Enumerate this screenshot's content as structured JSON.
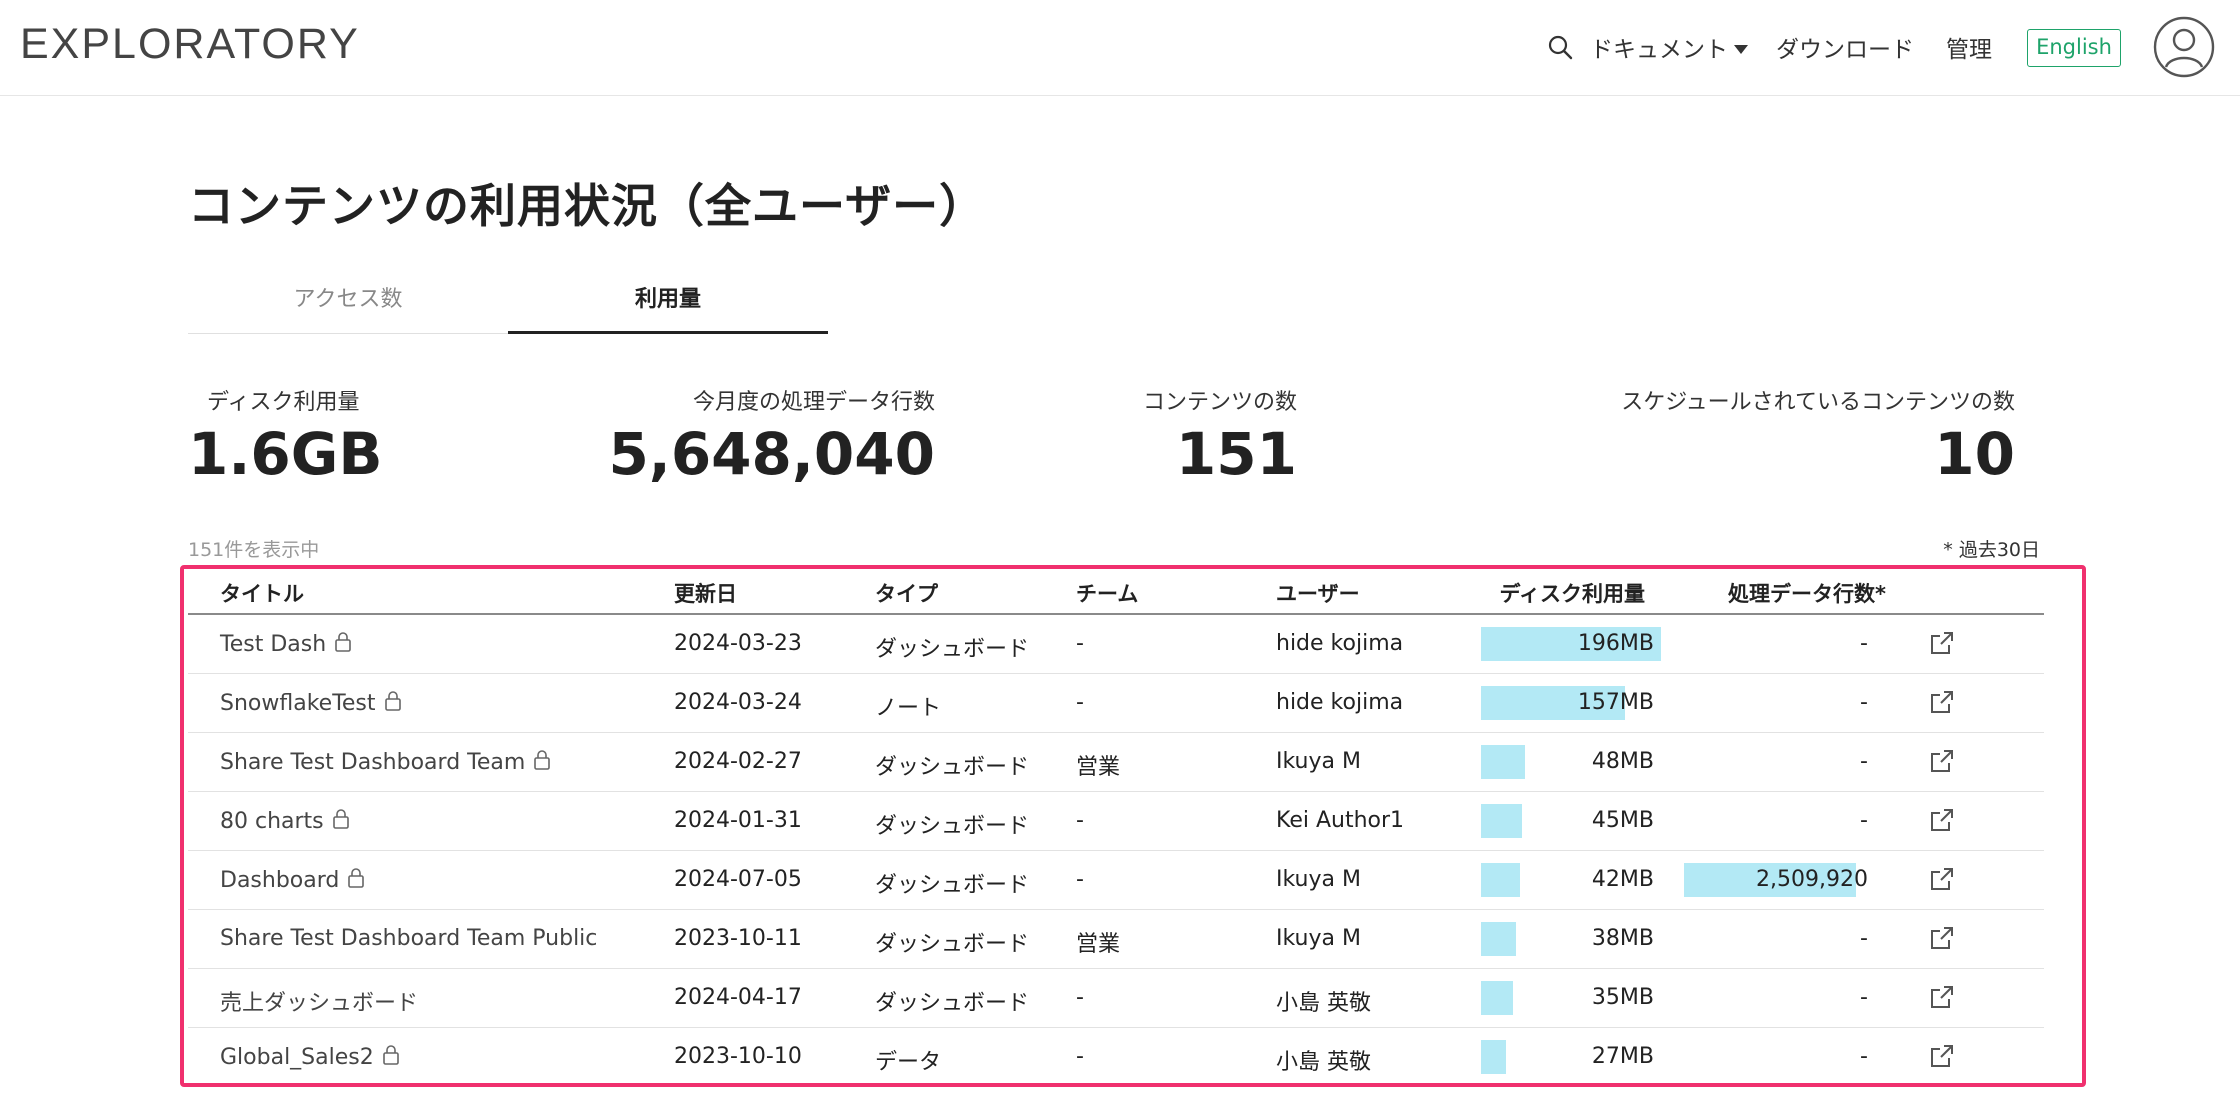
{
  "header": {
    "brand": "EXPLORATORY",
    "docs": "ドキュメント",
    "download": "ダウンロード",
    "admin": "管理",
    "language": "English"
  },
  "page": {
    "title": "コンテンツの利用状況（全ユーザー）"
  },
  "tabs": [
    {
      "label": "アクセス数",
      "active": false
    },
    {
      "label": "利用量",
      "active": true
    }
  ],
  "stats": [
    {
      "label": "ディスク利用量",
      "value": "1.6GB"
    },
    {
      "label": "今月度の処理データ行数",
      "value": "5,648,040"
    },
    {
      "label": "コンテンツの数",
      "value": "151"
    },
    {
      "label": "スケジュールされているコンテンツの数",
      "value": "10"
    }
  ],
  "table_meta": {
    "count_text": "151件を表示中",
    "note": "* 過去30日"
  },
  "table": {
    "headers": [
      "タイトル",
      "更新日",
      "タイプ",
      "チーム",
      "ユーザー",
      "ディスク利用量",
      "処理データ行数*"
    ],
    "rows": [
      {
        "title": "Test Dash",
        "locked": true,
        "date": "2024-03-23",
        "type": "ダッシュボード",
        "team": "-",
        "user": "hide kojima",
        "disk": "196MB",
        "disk_mb": 196,
        "rows": "-",
        "rows_num": 0
      },
      {
        "title": "SnowflakeTest",
        "locked": true,
        "date": "2024-03-24",
        "type": "ノート",
        "team": "-",
        "user": "hide kojima",
        "disk": "157MB",
        "disk_mb": 157,
        "rows": "-",
        "rows_num": 0
      },
      {
        "title": "Share Test Dashboard Team",
        "locked": true,
        "date": "2024-02-27",
        "type": "ダッシュボード",
        "team": "営業",
        "user": "Ikuya M",
        "disk": "48MB",
        "disk_mb": 48,
        "rows": "-",
        "rows_num": 0
      },
      {
        "title": "80 charts",
        "locked": true,
        "date": "2024-01-31",
        "type": "ダッシュボード",
        "team": "-",
        "user": "Kei Author1",
        "disk": "45MB",
        "disk_mb": 45,
        "rows": "-",
        "rows_num": 0
      },
      {
        "title": "Dashboard",
        "locked": true,
        "date": "2024-07-05",
        "type": "ダッシュボード",
        "team": "-",
        "user": "Ikuya M",
        "disk": "42MB",
        "disk_mb": 42,
        "rows": "2,509,920",
        "rows_num": 2509920
      },
      {
        "title": "Share Test Dashboard Team Public",
        "locked": false,
        "date": "2023-10-11",
        "type": "ダッシュボード",
        "team": "営業",
        "user": "Ikuya M",
        "disk": "38MB",
        "disk_mb": 38,
        "rows": "-",
        "rows_num": 0
      },
      {
        "title": "売上ダッシュボード",
        "locked": false,
        "date": "2024-04-17",
        "type": "ダッシュボード",
        "team": "-",
        "user": "小島 英敬",
        "disk": "35MB",
        "disk_mb": 35,
        "rows": "-",
        "rows_num": 0
      },
      {
        "title": "Global_Sales2",
        "locked": true,
        "date": "2023-10-10",
        "type": "データ",
        "team": "-",
        "user": "小島 英敬",
        "disk": "27MB",
        "disk_mb": 27,
        "rows": "-",
        "rows_num": 0
      }
    ]
  },
  "colors": {
    "bar": "#b3e9f5",
    "highlight": "#f0306e",
    "language_accent": "#1ea36a"
  },
  "icons": [
    "search-icon",
    "caret-down-icon",
    "user-avatar-icon",
    "lock-icon",
    "open-external-icon"
  ]
}
